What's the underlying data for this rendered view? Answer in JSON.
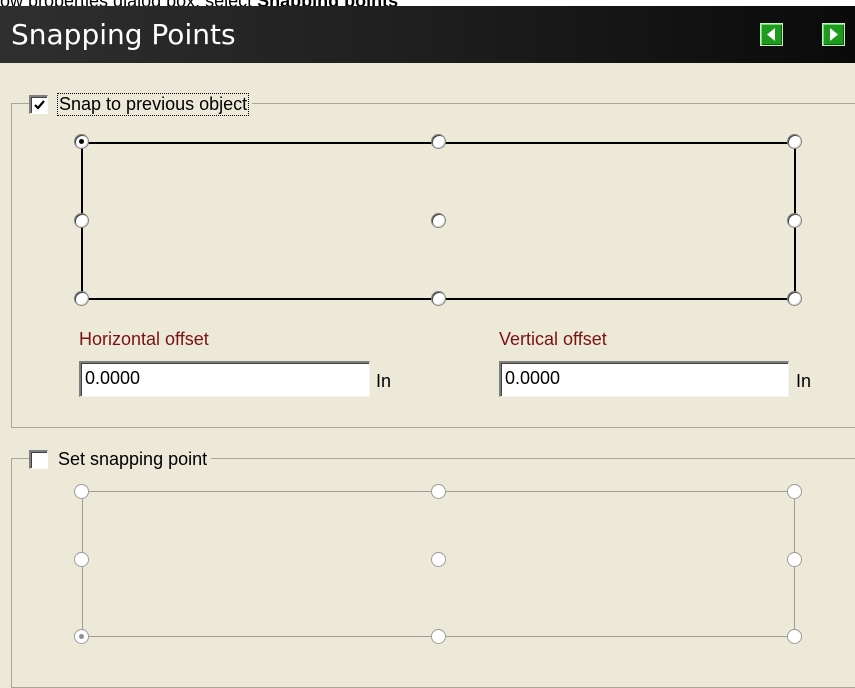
{
  "header_partial": {
    "text": "ow properties dialog box, select ",
    "bold": "Snapping points"
  },
  "titlebar": {
    "title": "Snapping Points",
    "prev_icon": "triangle-left-icon",
    "next_icon": "triangle-right-icon",
    "accent": "#1e9a1e"
  },
  "snap_group": {
    "label": "Snap to previous object",
    "checked": true,
    "selected_point": "top-left",
    "points": [
      "top-left",
      "top-center",
      "top-right",
      "middle-left",
      "center",
      "middle-right",
      "bottom-left",
      "bottom-center",
      "bottom-right"
    ]
  },
  "horizontal_offset": {
    "label": "Horizontal offset",
    "value": "0.0000",
    "unit": "In"
  },
  "vertical_offset": {
    "label": "Vertical offset",
    "value": "0.0000",
    "unit": "In"
  },
  "set_group": {
    "label": "Set snapping point",
    "checked": false,
    "selected_point": "bottom-left",
    "enabled": false
  },
  "colors": {
    "label_red": "#7a1212",
    "panel_bg": "#ece9d8"
  }
}
